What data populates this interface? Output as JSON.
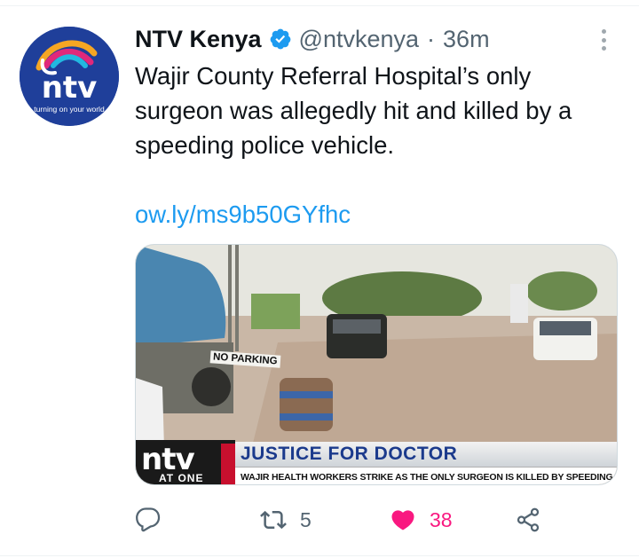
{
  "tweet": {
    "author_name": "NTV Kenya",
    "handle": "@ntvkenya",
    "separator": "·",
    "time": "36m",
    "text": "Wajir County Referral Hospital’s only surgeon was allegedly hit and killed by a speeding police vehicle.",
    "link": "ow.ly/ms9b50GYfhc",
    "verified": true
  },
  "avatar": {
    "logo_text": "ntv",
    "tagline": "turning on your world"
  },
  "media": {
    "sign_text": "NO PARKING",
    "banner_logo": "ntv",
    "banner_logo_sub": "AT ONE",
    "headline": "JUSTICE FOR DOCTOR",
    "subheadline": "WAJIR HEALTH WORKERS STRIKE AS THE ONLY SURGEON IS KILLED BY SPEEDING POLICE VEHICLE"
  },
  "actions": {
    "reply_count": "",
    "retweet_count": "5",
    "like_count": "38",
    "liked": true,
    "icons": [
      "reply-icon",
      "retweet-icon",
      "heart-icon",
      "share-icon"
    ]
  },
  "colors": {
    "link": "#1d9bf0",
    "like": "#f91880",
    "secondary_text": "#536471",
    "verified": "#1d9bf0",
    "ntv_blue": "#1f3f9a"
  }
}
